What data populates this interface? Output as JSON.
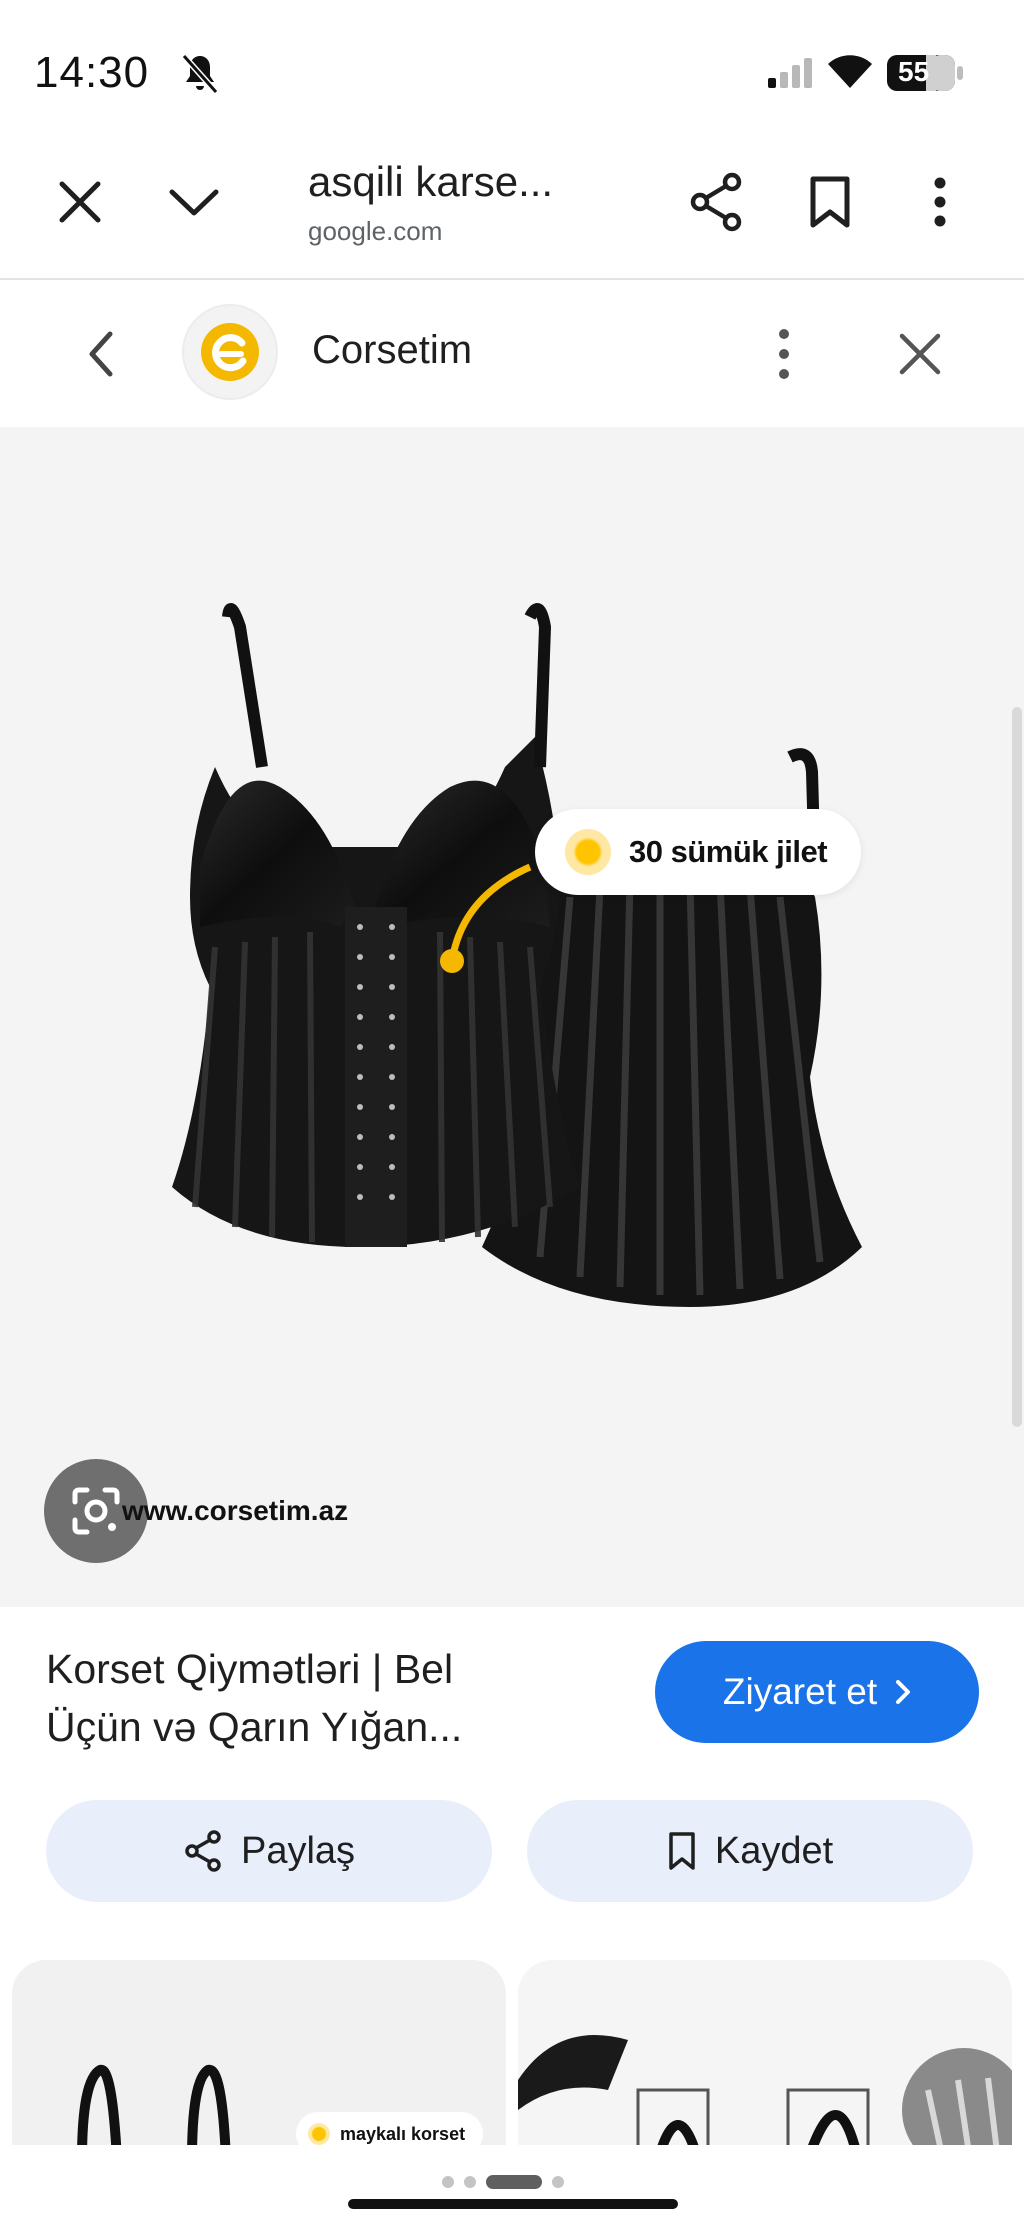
{
  "status_bar": {
    "time": "14:30",
    "battery": "55",
    "icons": [
      "bell-off-icon",
      "signal-icon",
      "wifi-icon",
      "battery-icon"
    ]
  },
  "toolbar": {
    "title": "asqili karse...",
    "domain": "google.com",
    "icons": [
      "close-icon",
      "chevron-down-icon",
      "share-icon",
      "bookmark-icon",
      "more-vert-icon"
    ]
  },
  "source": {
    "name": "Corsetim",
    "logo_color": "#f5b800"
  },
  "image": {
    "callout": "30 sümük jilet",
    "watermark": "www.corsetim.az"
  },
  "result": {
    "title_line1": "Korset Qiymətləri | Bel",
    "title_line2": "Üçün və Qarın Yığan...",
    "visit_label": "Ziyaret et",
    "share_label": "Paylaş",
    "save_label": "Kaydet",
    "accent_color": "#1a73e8"
  },
  "related": {
    "items": [
      {
        "tag": "maykalı korset"
      },
      {
        "tag": ""
      }
    ]
  }
}
